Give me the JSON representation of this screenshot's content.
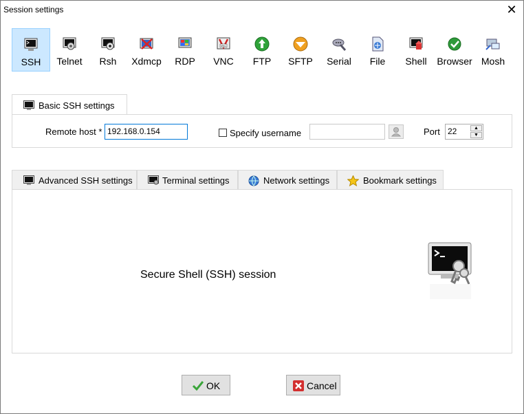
{
  "window": {
    "title": "Session settings",
    "close_glyph": "✕"
  },
  "session_types": [
    {
      "label": "SSH",
      "icon": "ssh-terminal-icon",
      "selected": true
    },
    {
      "label": "Telnet",
      "icon": "telnet-icon"
    },
    {
      "label": "Rsh",
      "icon": "rsh-icon"
    },
    {
      "label": "Xdmcp",
      "icon": "xdmcp-icon"
    },
    {
      "label": "RDP",
      "icon": "rdp-icon"
    },
    {
      "label": "VNC",
      "icon": "vnc-icon"
    },
    {
      "label": "FTP",
      "icon": "ftp-icon"
    },
    {
      "label": "SFTP",
      "icon": "sftp-icon"
    },
    {
      "label": "Serial",
      "icon": "serial-icon"
    },
    {
      "label": "File",
      "icon": "file-icon"
    },
    {
      "label": "Shell",
      "icon": "shell-icon"
    },
    {
      "label": "Browser",
      "icon": "browser-icon"
    },
    {
      "label": "Mosh",
      "icon": "mosh-icon"
    }
  ],
  "basic": {
    "tab_label": "Basic SSH settings",
    "remote_host_label": "Remote host *",
    "remote_host_value": "192.168.0.154",
    "specify_username_label": "Specify username",
    "specify_username_checked": false,
    "username_value": "",
    "port_label": "Port",
    "port_value": "22"
  },
  "tabs": [
    {
      "label": "Advanced SSH settings",
      "icon": "terminal-icon"
    },
    {
      "label": "Terminal settings",
      "icon": "terminal-settings-icon"
    },
    {
      "label": "Network settings",
      "icon": "globe-icon"
    },
    {
      "label": "Bookmark settings",
      "icon": "star-icon"
    }
  ],
  "main": {
    "description": "Secure Shell (SSH) session"
  },
  "buttons": {
    "ok_label": "OK",
    "cancel_label": "Cancel"
  },
  "colors": {
    "selection_bg": "#cce8ff",
    "selection_border": "#99d1ff",
    "focus_border": "#0078d7"
  }
}
